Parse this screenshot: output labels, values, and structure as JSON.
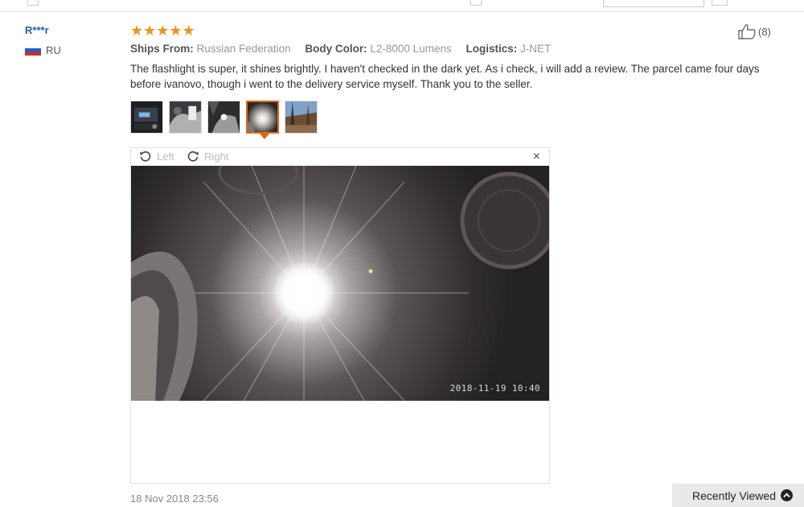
{
  "user": {
    "name": "R***r",
    "country_code": "RU"
  },
  "review": {
    "rating": 5,
    "meta": [
      {
        "key": "Ships From:",
        "value": "Russian Federation"
      },
      {
        "key": "Body Color:",
        "value": "L2-8000 Lumens"
      },
      {
        "key": "Logistics:",
        "value": "J-NET"
      }
    ],
    "text": "The flashlight is super, it shines brightly. I haven't checked in the dark yet. As i check, i will add a review. The parcel came four days before ivanovo, though i went to the delivery service myself. Thank you to the seller.",
    "helpful_count": "(8)",
    "date": "18 Nov 2018 23:56"
  },
  "photos": {
    "count": 5,
    "active_index": 3
  },
  "viewer": {
    "rotate_left": "Left",
    "rotate_right": "Right",
    "close": "×",
    "timestamp": "2018-11-19 10:40"
  },
  "recently_viewed": {
    "label": "Recently Viewed"
  },
  "colors": {
    "accent": "#e66418",
    "star": "#f2901c",
    "username": "#1c5fb0"
  }
}
